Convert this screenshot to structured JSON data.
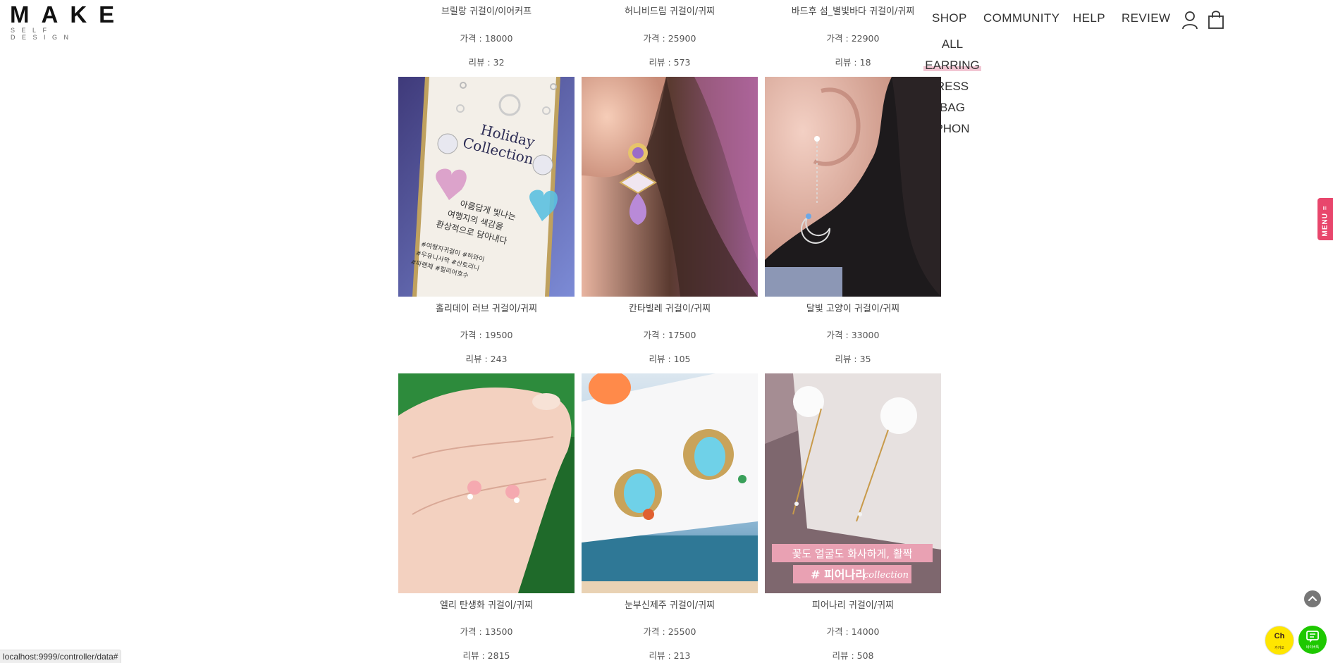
{
  "logo": {
    "word": "MAKE",
    "sub": "SELF DESIGN"
  },
  "nav": {
    "shop": "SHOP",
    "community": "COMMUNITY",
    "help": "HELP",
    "review": "REVIEW",
    "user_icon": "user-icon",
    "cart_icon": "shopping-bag-icon"
  },
  "dropdown": [
    "ALL",
    "EARRING",
    "RESS",
    "BAG",
    "PHON"
  ],
  "products": [
    {
      "name": "브릴랑 귀걸이/이어커프",
      "price": "가격 : 18000",
      "review": "리뷰 : 32"
    },
    {
      "name": "허니비드림 귀걸이/귀찌",
      "price": "가격 : 25900",
      "review": "리뷰 : 573"
    },
    {
      "name": "바드후 섬_별빛바다 귀걸이/귀찌",
      "price": "가격 : 22900",
      "review": "리뷰 : 18"
    },
    {
      "name": "홀리데이 러브 귀걸이/귀찌",
      "price": "가격 : 19500",
      "review": "리뷰 : 243",
      "image_text": [
        "Holiday",
        "Collection",
        "아름답게 빛나는",
        "여행지의 색감을",
        "환상적으로 담아내다",
        "#여행지귀걸이 #하와이",
        "#우유니사막 #산토리니",
        "#파랜체 #힐리어호수"
      ]
    },
    {
      "name": "칸타빌레 귀걸이/귀찌",
      "price": "가격 : 17500",
      "review": "리뷰 : 105"
    },
    {
      "name": "달빛 고양이 귀걸이/귀찌",
      "price": "가격 : 33000",
      "review": "리뷰 : 35"
    },
    {
      "name": "엘리 탄생화 귀걸이/귀찌",
      "price": "가격 : 13500",
      "review": "리뷰 : 2815"
    },
    {
      "name": "눈부신제주 귀걸이/귀찌",
      "price": "가격 : 25500",
      "review": "리뷰 : 213"
    },
    {
      "name": "피어나리 귀걸이/귀찌",
      "price": "가격 : 14000",
      "review": "리뷰 : 508",
      "image_text": [
        "꽃도 얼굴도 화사하게, 활짝",
        "# 피어나리",
        "collection"
      ]
    }
  ],
  "side_menu": "MENU ≡",
  "kakao": {
    "badge": "Ch",
    "label": "카카오"
  },
  "talk": {
    "label": "네이버톡"
  },
  "status_bar": "localhost:9999/controller/data#",
  "colors": {
    "accent_pink": "#e8466c",
    "highlight": "#f2c6d3"
  }
}
